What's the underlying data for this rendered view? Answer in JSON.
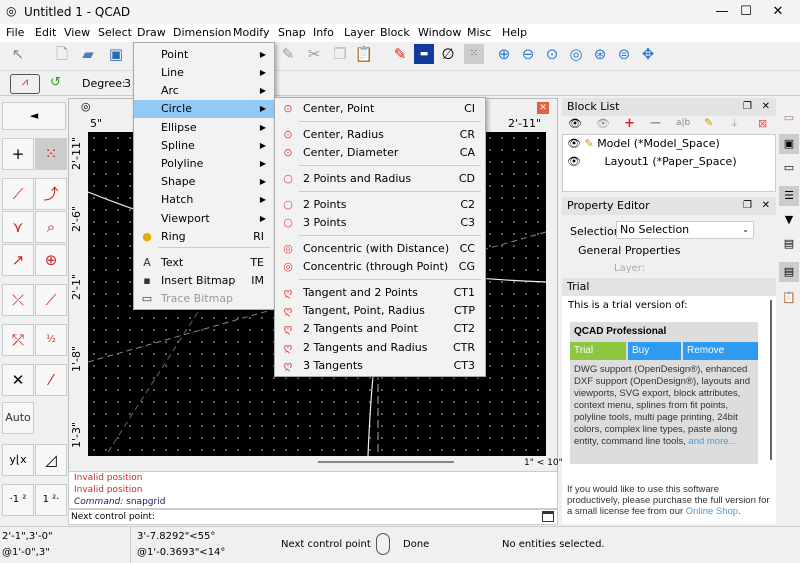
{
  "window": {
    "title": "Untitled 1 - QCAD",
    "minimize": "—",
    "maximize": "☐",
    "close": "✕"
  },
  "menubar": [
    "File",
    "Edit",
    "View",
    "Select",
    "Draw",
    "Dimension",
    "Modify",
    "Snap",
    "Info",
    "Layer",
    "Block",
    "Window",
    "Misc",
    "Help"
  ],
  "snap_toolbar": {
    "degree_label": "Degree:",
    "degree_value": "3"
  },
  "left_toolbar": {
    "back": "◄",
    "auto": "Auto"
  },
  "drawing": {
    "ruler_top": [
      "5\"",
      "2'-11\""
    ],
    "ruler_left": [
      "2'-11\"",
      "2'-6\"",
      "2'-1\"",
      "1'-8\"",
      "1'-3\""
    ],
    "grid_info": "1\" < 10\""
  },
  "command": {
    "history": [
      "Invalid position",
      "Invalid position"
    ],
    "command_label": "Command:",
    "command_value": " snapgrid",
    "input_label": "Next control point:"
  },
  "status": {
    "abs_coord": "2'-1\",3'-0\"",
    "rel_coord": "@1'-0\",3\"",
    "abs_polar": "3'-7.8292\"<55°",
    "rel_polar": "@1'-0.3693\"<14°",
    "left_action": "Next control point",
    "right_action": "Done",
    "selection": "No entities selected."
  },
  "block_list": {
    "title": "Block List",
    "items": [
      {
        "name": "Model (*Model_Space)"
      },
      {
        "name": "Layout1 (*Paper_Space)"
      }
    ]
  },
  "property_editor": {
    "title": "Property Editor",
    "selection_label": "Selection:",
    "selection_value": "No Selection",
    "group": "General Properties",
    "layer_label": "Layer:"
  },
  "trial": {
    "title": "Trial",
    "intro": "This is a trial version of:",
    "product": "QCAD Professional",
    "tabs": [
      "Trial",
      "Buy",
      "Remove"
    ],
    "features": "DWG support (OpenDesign®), enhanced DXF support (OpenDesign®), layouts and viewports, SVG export, block attributes, context menu, splines from fit points, polyline tools, multi page printing, 24bit colors, complex line types, paste along entity, command line tools, ",
    "more": "and more...",
    "purchase": "If you would like to use this software productively, please purchase the full version for a small license fee from our ",
    "shop": "Online Shop",
    "end": ".",
    "colors": {
      "trial": "#8dc63f",
      "buy": "#2e9bf0"
    }
  },
  "draw_menu": [
    {
      "label": "Point",
      "sub": true
    },
    {
      "label": "Line",
      "sub": true
    },
    {
      "label": "Arc",
      "sub": true
    },
    {
      "label": "Circle",
      "sub": true,
      "active": true
    },
    {
      "label": "Ellipse",
      "sub": true
    },
    {
      "label": "Spline",
      "sub": true
    },
    {
      "label": "Polyline",
      "sub": true
    },
    {
      "label": "Shape",
      "sub": true
    },
    {
      "label": "Hatch",
      "sub": true
    },
    {
      "label": "Viewport",
      "sub": true
    },
    {
      "label": "Ring",
      "shortcut": "RI",
      "icon": "●"
    },
    {
      "label": "Text",
      "shortcut": "TE",
      "icon": "A"
    },
    {
      "label": "Insert Bitmap",
      "shortcut": "IM",
      "icon": "▪"
    },
    {
      "label": "Trace Bitmap",
      "disabled": true,
      "icon": "▭"
    }
  ],
  "circle_menu": [
    {
      "label": "Center, Point",
      "shortcut": "CI"
    },
    {
      "label": "Center, Radius",
      "shortcut": "CR"
    },
    {
      "label": "Center, Diameter",
      "shortcut": "CA"
    },
    {
      "label": "2 Points and Radius",
      "shortcut": "CD"
    },
    {
      "label": "2 Points",
      "shortcut": "C2"
    },
    {
      "label": "3 Points",
      "shortcut": "C3"
    },
    {
      "label": "Concentric (with Distance)",
      "shortcut": "CC"
    },
    {
      "label": "Concentric (through Point)",
      "shortcut": "CG"
    },
    {
      "label": "Tangent and 2 Points",
      "shortcut": "CT1"
    },
    {
      "label": "Tangent, Point, Radius",
      "shortcut": "CTP"
    },
    {
      "label": "2 Tangents and Point",
      "shortcut": "CT2"
    },
    {
      "label": "2 Tangents and Radius",
      "shortcut": "CTR"
    },
    {
      "label": "3 Tangents",
      "shortcut": "CT3"
    }
  ]
}
